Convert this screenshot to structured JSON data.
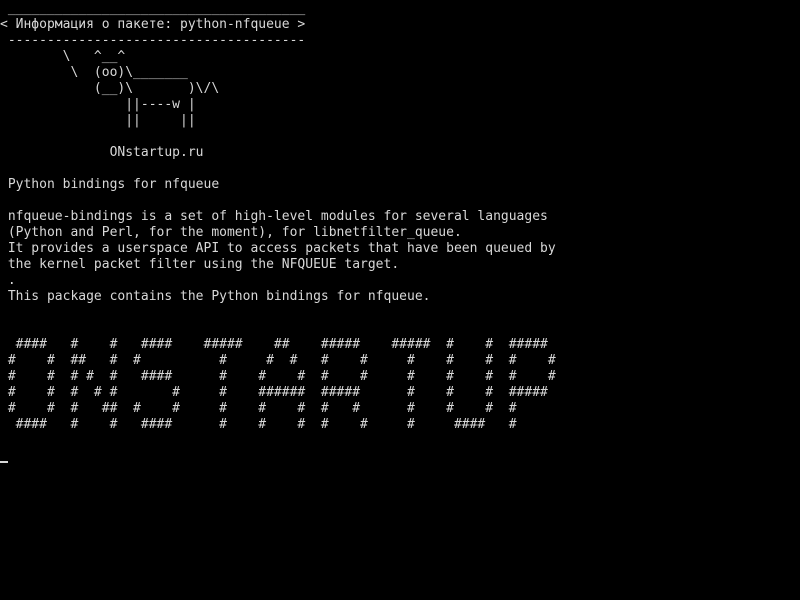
{
  "terminal": {
    "foreground": "#d8d8d8",
    "background": "#000000",
    "lines": [
      " ______________________________________",
      "< Информация о пакете: python-nfqueue >",
      " --------------------------------------",
      "        \\   ^__^",
      "         \\  (oo)\\_______",
      "            (__)\\       )\\/\\",
      "                ||----w |",
      "                ||     ||",
      "",
      "              ONstartup.ru",
      "",
      " Python bindings for nfqueue",
      "",
      " nfqueue-bindings is a set of high-level modules for several languages",
      " (Python and Perl, for the moment), for libnetfilter_queue.",
      " It provides a userspace API to access packets that have been queued by",
      " the kernel packet filter using the NFQUEUE target.",
      " .",
      " This package contains the Python bindings for nfqueue.",
      "",
      "",
      "  ####   #    #   ####    #####    ##    #####    #####  #    #  #####",
      " #    #  ##   #  #          #     #  #   #    #     #    #    #  #    #",
      " #    #  # #  #   ####      #    #    #  #    #     #    #    #  #    #",
      " #    #  #  # #       #     #    ######  #####      #    #    #  #####",
      " #    #  #   ##  #    #     #    #    #  #   #      #    #    #  #",
      "  ####   #    #   ####      #    #    #  #    #     #     ####   #"
    ]
  }
}
